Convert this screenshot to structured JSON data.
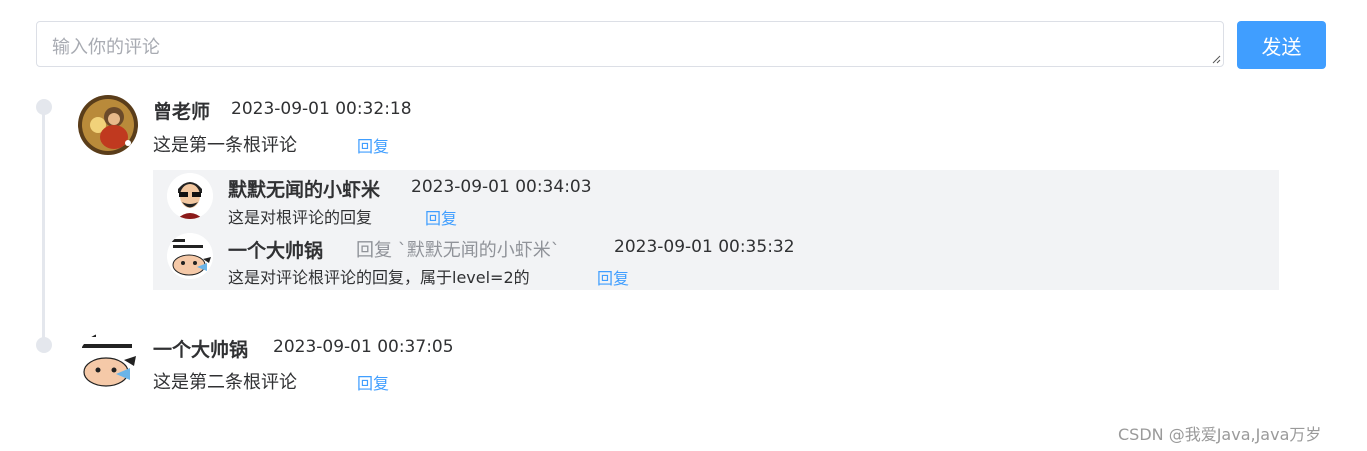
{
  "comment_input": {
    "placeholder": "输入你的评论",
    "value": ""
  },
  "send_button": {
    "label": "发送"
  },
  "comments": [
    {
      "user": "曾老师",
      "time": "2023-09-01 00:32:18",
      "content": "这是第一条根评论",
      "reply_label": "回复",
      "replies": [
        {
          "user": "默默无闻的小虾米",
          "time": "2023-09-01 00:34:03",
          "content": "这是对根评论的回复",
          "reply_label": "回复"
        },
        {
          "user": "一个大帅锅",
          "reply_to": "回复 `默默无闻的小虾米`",
          "time": "2023-09-01 00:35:32",
          "content": "这是对评论根评论的回复，属于level=2的",
          "reply_label": "回复"
        }
      ]
    },
    {
      "user": "一个大帅锅",
      "time": "2023-09-01 00:37:05",
      "content": "这是第二条根评论",
      "reply_label": "回复"
    }
  ],
  "watermark": "CSDN @我爱Java,Java万岁",
  "colors": {
    "primary": "#409eff",
    "sub_bg": "#f2f3f5",
    "timeline": "#e4e7ed"
  }
}
